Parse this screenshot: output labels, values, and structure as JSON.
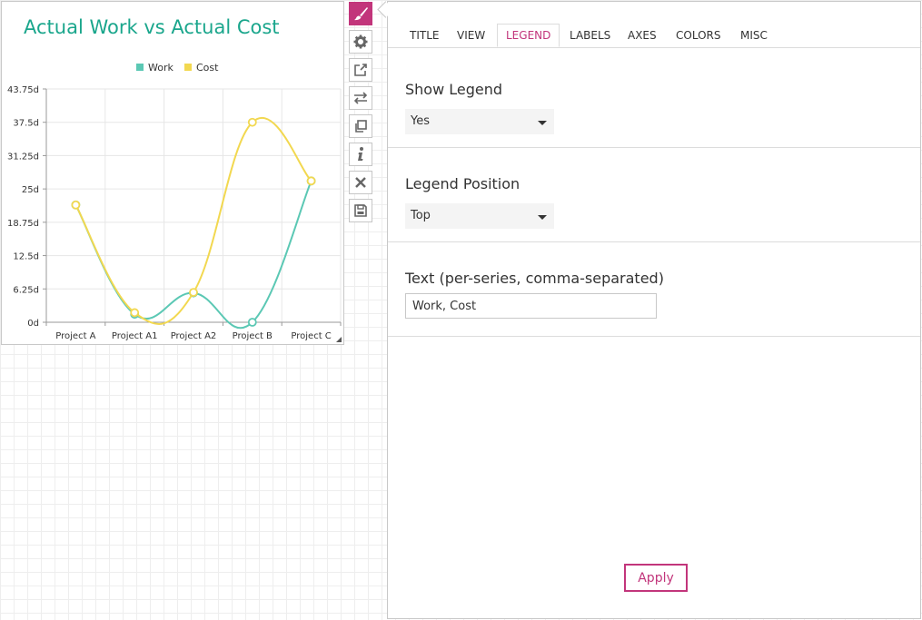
{
  "chart": {
    "title": "Actual Work vs Actual Cost"
  },
  "chart_data": {
    "type": "line",
    "title": "Actual Work vs Actual Cost",
    "categories": [
      "Project A",
      "Project A1",
      "Project A2",
      "Project B",
      "Project C"
    ],
    "series": [
      {
        "name": "Work",
        "values": [
          22,
          1.5,
          5.5,
          0,
          26.5
        ],
        "color": "#5bc8b4"
      },
      {
        "name": "Cost",
        "values": [
          22,
          1.8,
          5.6,
          37.5,
          26.5
        ],
        "color": "#f2d850"
      }
    ],
    "yticks": [
      "0d",
      "6.25d",
      "12.5d",
      "18.75d",
      "25d",
      "31.25d",
      "37.5d",
      "43.75d"
    ],
    "ylim": [
      0,
      43.75
    ],
    "legend_position": "top",
    "grid": true
  },
  "toolbar": {
    "icons": [
      "brush-icon",
      "gear-icon",
      "external-link-icon",
      "swap-icon",
      "copy-icon",
      "info-icon",
      "close-icon",
      "save-icon"
    ],
    "accent": "#c2357b"
  },
  "panel": {
    "tabs": [
      "TITLE",
      "VIEW",
      "LEGEND",
      "LABELS",
      "AXES",
      "COLORS",
      "MISC"
    ],
    "active_tab": "LEGEND",
    "show_legend": {
      "label": "Show Legend",
      "value": "Yes"
    },
    "legend_position": {
      "label": "Legend Position",
      "value": "Top"
    },
    "legend_text": {
      "label": "Text (per-series, comma-separated)",
      "value": "Work, Cost"
    },
    "apply_label": "Apply"
  }
}
